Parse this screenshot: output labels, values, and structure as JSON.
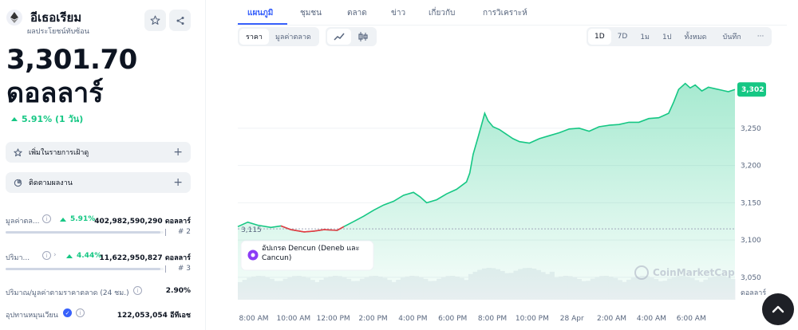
{
  "coin": {
    "name": "อีเธอเรียม",
    "subtitle": "ผลประโยชน์ทับซ้อน",
    "price": "3,301.70",
    "price_unit": "ดอลลาร์",
    "change": "5.91% (1 วัน)"
  },
  "actions": {
    "watchlist": "เพิ่มในรายการเฝ้าดู",
    "track": "ติดตามผลงาน"
  },
  "stats": {
    "market_cap": {
      "label": "มูลค่าตล...",
      "change": "5.91%",
      "value": "402,982,590,290 ดอลลาร์",
      "rank": "# 2",
      "fill": 0.98
    },
    "volume": {
      "label": "ปริมา...",
      "change": "4.44%",
      "value": "11,622,950,827 ดอลลาร์",
      "rank": "# 3",
      "fill": 0.98
    },
    "vol_mcap": {
      "label": "ปริมาณ/มูลค่าตามราคาตลาด (24 ชม.)",
      "value": "2.90%"
    },
    "circulating": {
      "label": "อุปทานหมุนเวียน",
      "value": "122,053,054 อีทีเอช"
    }
  },
  "tabs": [
    "แผนภูมิ",
    "ชุมชน",
    "ตลาด",
    "ข่าว",
    "เกี่ยวกับ",
    "การวิเคราะห์"
  ],
  "chart_toggle": {
    "price": "ราคา",
    "mcap": "มูลค่าตลาด"
  },
  "timeframes": [
    "1D",
    "7D",
    "1ม",
    "1ป",
    "ทั้งหมด",
    "บันทึก",
    "···"
  ],
  "chart_data": {
    "type": "area",
    "x_labels": [
      "8:00 AM",
      "10:00 AM",
      "12:00 PM",
      "2:00 PM",
      "4:00 PM",
      "6:00 PM",
      "8:00 PM",
      "10:00 PM",
      "28 Apr",
      "2:00 AM",
      "4:00 AM",
      "6:00 AM"
    ],
    "y_ticks": [
      3050,
      3100,
      3150,
      3200,
      3250
    ],
    "y_unit_label": "ดอลลาร์",
    "ylim": [
      3020,
      3330
    ],
    "baseline": 3115,
    "baseline_label": "3,115",
    "current_label": "3,302",
    "event_label": "อัปเกรด Dencun (Deneb และ Cancun)",
    "watermark": "CoinMarketCap",
    "points": [
      [
        0,
        3118
      ],
      [
        0.3,
        3124
      ],
      [
        0.6,
        3120
      ],
      [
        1.0,
        3117
      ],
      [
        1.3,
        3119
      ],
      [
        1.6,
        3114
      ],
      [
        2.0,
        3111
      ],
      [
        2.3,
        3112
      ],
      [
        2.6,
        3114
      ],
      [
        3.0,
        3113
      ],
      [
        3.2,
        3118
      ],
      [
        3.5,
        3125
      ],
      [
        3.8,
        3132
      ],
      [
        4.1,
        3140
      ],
      [
        4.4,
        3147
      ],
      [
        4.7,
        3152
      ],
      [
        5.0,
        3160
      ],
      [
        5.3,
        3164
      ],
      [
        5.5,
        3158
      ],
      [
        5.7,
        3150
      ],
      [
        6.0,
        3154
      ],
      [
        6.3,
        3162
      ],
      [
        6.6,
        3168
      ],
      [
        6.9,
        3178
      ],
      [
        7.0,
        3190
      ],
      [
        7.1,
        3215
      ],
      [
        7.25,
        3238
      ],
      [
        7.35,
        3254
      ],
      [
        7.45,
        3270
      ],
      [
        7.55,
        3260
      ],
      [
        7.7,
        3252
      ],
      [
        7.9,
        3248
      ],
      [
        8.1,
        3242
      ],
      [
        8.3,
        3236
      ],
      [
        8.5,
        3232
      ],
      [
        8.8,
        3230
      ],
      [
        9.1,
        3236
      ],
      [
        9.4,
        3240
      ],
      [
        9.7,
        3244
      ],
      [
        10.0,
        3249
      ],
      [
        10.3,
        3250
      ],
      [
        10.6,
        3246
      ],
      [
        10.9,
        3252
      ],
      [
        11.2,
        3254
      ],
      [
        11.5,
        3255
      ],
      [
        11.8,
        3258
      ],
      [
        12.1,
        3258
      ],
      [
        12.4,
        3263
      ],
      [
        12.7,
        3264
      ],
      [
        13.0,
        3270
      ],
      [
        13.15,
        3285
      ],
      [
        13.3,
        3302
      ],
      [
        13.5,
        3310
      ],
      [
        13.65,
        3304
      ],
      [
        13.8,
        3308
      ],
      [
        14.0,
        3300
      ],
      [
        14.2,
        3305
      ],
      [
        14.4,
        3303
      ],
      [
        14.6,
        3301
      ],
      [
        14.8,
        3299
      ],
      [
        15.0,
        3302
      ]
    ]
  }
}
